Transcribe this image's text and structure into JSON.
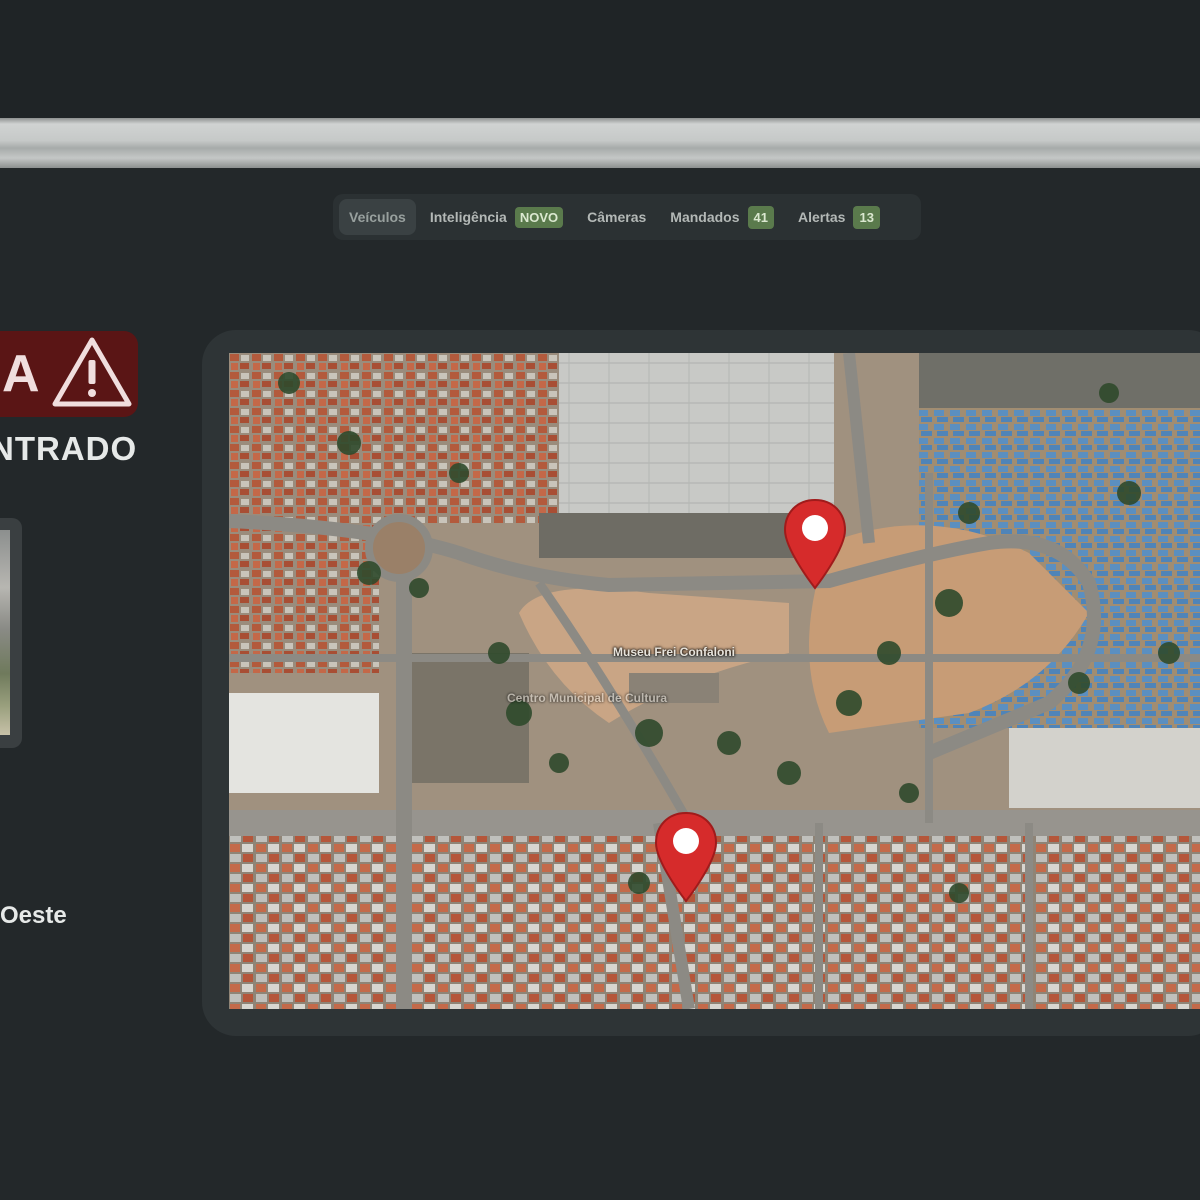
{
  "tabs": [
    {
      "label": "Veículos",
      "badge": null,
      "active": true
    },
    {
      "label": "Inteligência",
      "badge": "NOVO",
      "active": false
    },
    {
      "label": "Câmeras",
      "badge": null,
      "active": false
    },
    {
      "label": "Mandados",
      "badge": "41",
      "active": false
    },
    {
      "label": "Alertas",
      "badge": "13",
      "active": false
    }
  ],
  "alert": {
    "letter": "A",
    "status": "NTRADO",
    "icon": "warning-triangle-icon",
    "color": "#5a1515"
  },
  "location": "Oeste",
  "map": {
    "labels": {
      "museum": "Museu Frei Confaloni",
      "building": "Centro Municipal de Cultura"
    },
    "pins": [
      "pin-icon",
      "pin-icon"
    ],
    "pin_color": "#d62b2b"
  }
}
